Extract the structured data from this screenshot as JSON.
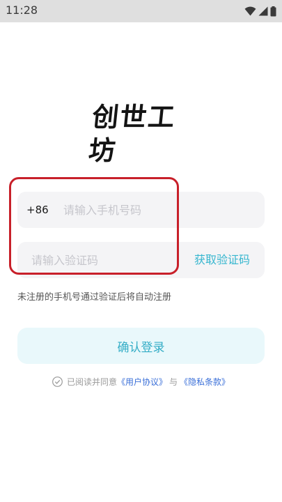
{
  "status_bar": {
    "time": "11:28",
    "icons": [
      "wifi-icon",
      "cellular-signal-icon",
      "battery-icon"
    ]
  },
  "logo": {
    "text": "创世工坊"
  },
  "phone": {
    "country_code": "+86",
    "placeholder": "请输入手机号码",
    "value": ""
  },
  "verification": {
    "placeholder": "请输入验证码",
    "value": "",
    "get_code_label": "获取验证码"
  },
  "hint": "未注册的手机号通过验证后将自动注册",
  "login_button": {
    "label": "确认登录"
  },
  "agreement": {
    "checked": false,
    "prefix": "已阅读并同意",
    "user_agreement": "《用户协议》",
    "separator": "与",
    "privacy_policy": "《隐私条款》"
  },
  "colors": {
    "accent": "#36b6cf",
    "login_button_bg": "#e9f8fb",
    "input_bg": "#f4f4f6",
    "link": "#3a6fd8",
    "highlight": "#c8202a"
  }
}
